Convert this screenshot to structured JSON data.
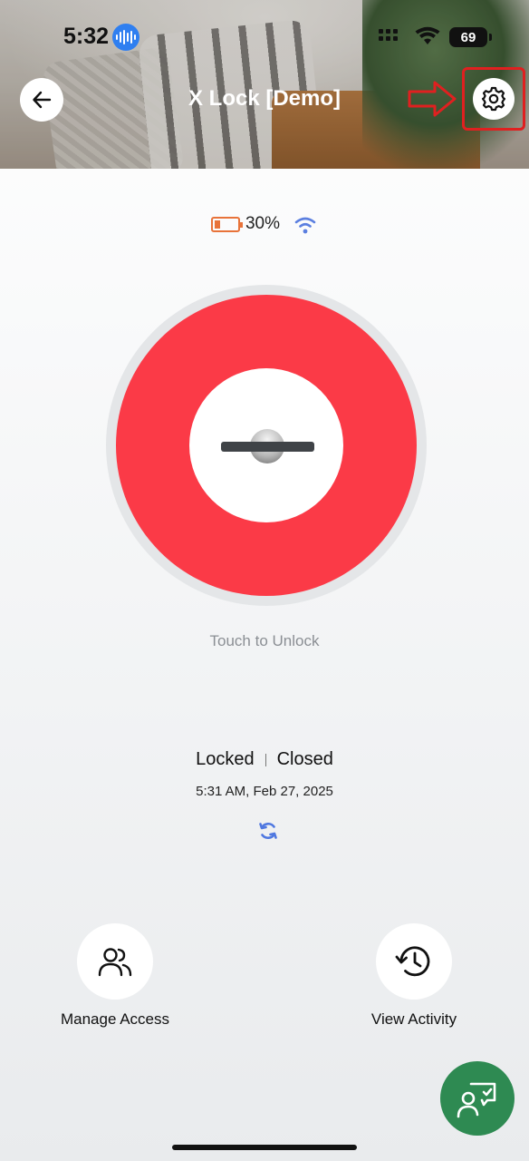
{
  "status_bar": {
    "time": "5:32",
    "battery": "69"
  },
  "header": {
    "title": "X Lock [Demo]",
    "back_icon": "arrow-left-icon",
    "settings_icon": "gear-icon",
    "annotation": "red-arrow-pointing-to-settings"
  },
  "device": {
    "battery_percent": "30%",
    "battery_color": "#e8733a",
    "wifi_color": "#5b7fe0"
  },
  "lock": {
    "state_color": "#fb3a47",
    "hint": "Touch to Unlock"
  },
  "status": {
    "lock_state": "Locked",
    "door_state": "Closed",
    "timestamp": "5:31 AM, Feb 27, 2025",
    "refresh_icon": "refresh-icon"
  },
  "actions": [
    {
      "label": "Manage Access",
      "icon": "users-icon"
    },
    {
      "label": "View Activity",
      "icon": "history-icon"
    }
  ],
  "fab": {
    "icon": "chat-support-icon",
    "color": "#2e8a52"
  }
}
